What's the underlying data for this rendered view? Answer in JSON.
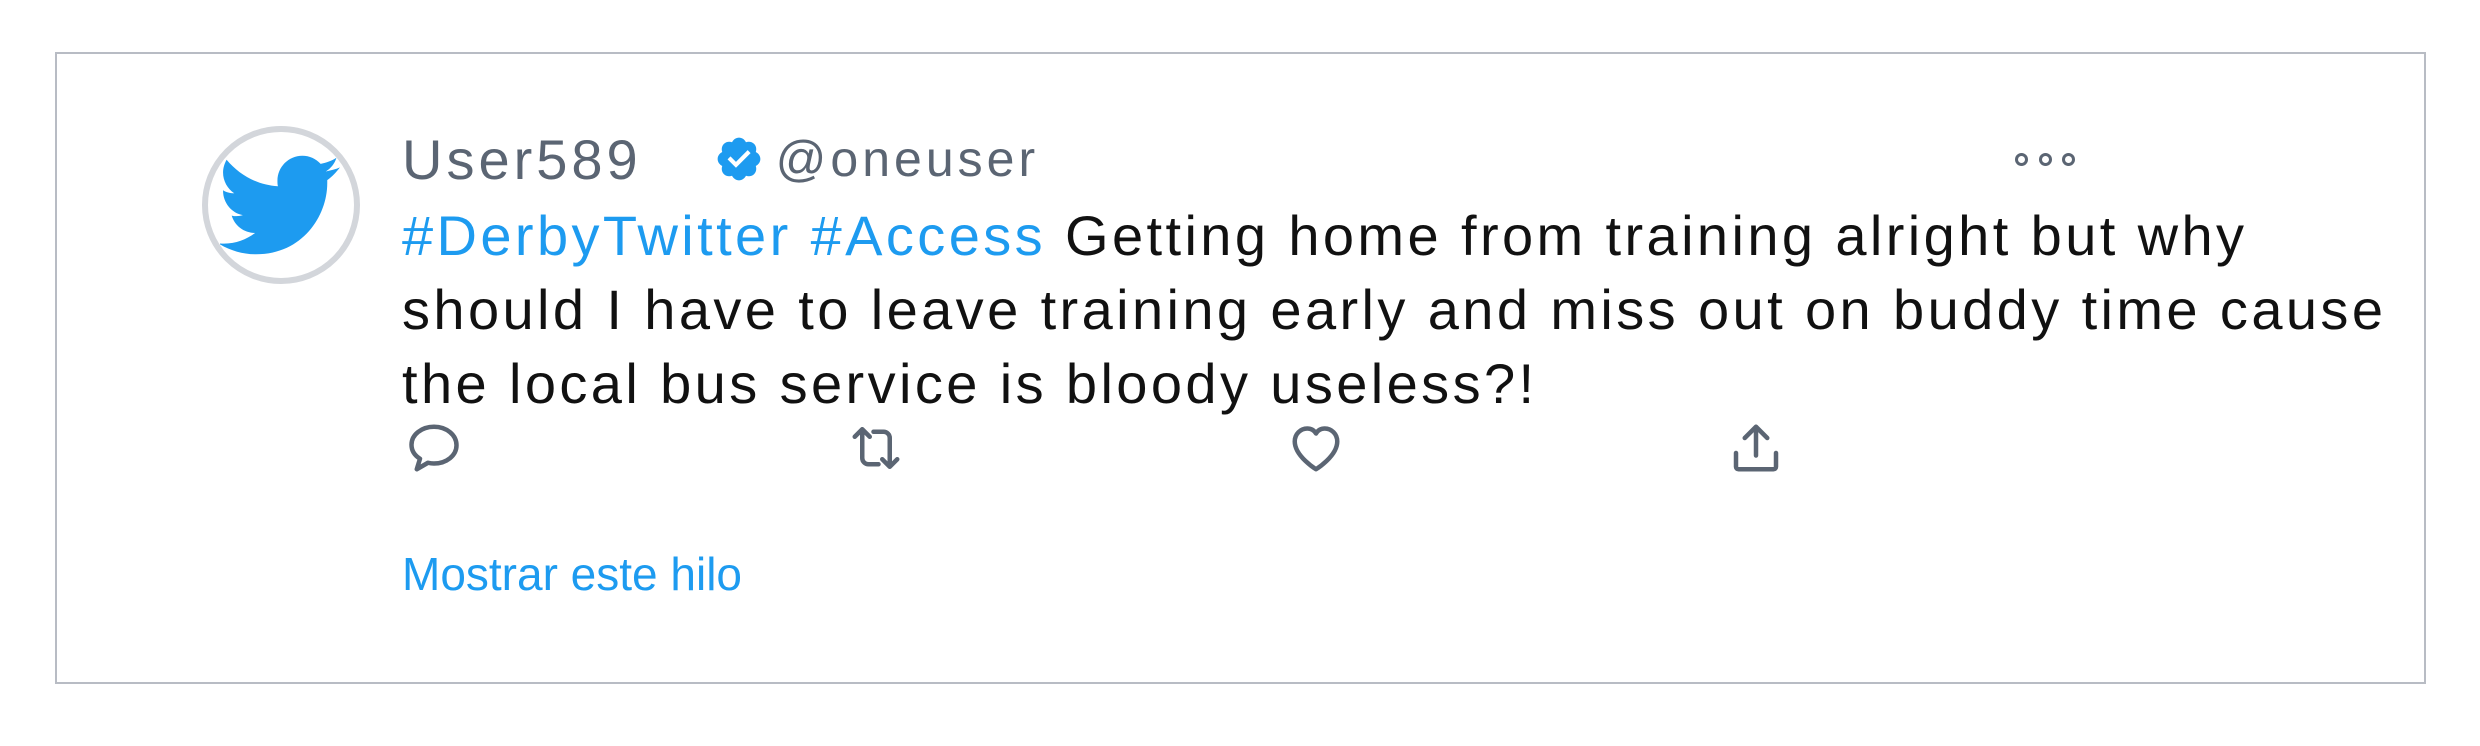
{
  "tweet": {
    "display_name": "User589",
    "handle": "@oneuser",
    "verified": true,
    "hashtags": [
      "#DerbyTwitter",
      "#Access"
    ],
    "body": "Getting home from training alright but why should I have to leave training early and miss out on buddy time cause the local bus service is bloody useless?!",
    "avatar_icon": "twitter-bird-icon",
    "more_icon": "more-options-icon"
  },
  "actions": {
    "reply_icon": "reply-icon",
    "retweet_icon": "retweet-icon",
    "like_icon": "like-icon",
    "share_icon": "share-icon"
  },
  "show_thread_label": "Mostrar este hilo",
  "colors": {
    "accent": "#1d9bf0",
    "muted": "#5b6573",
    "text": "#111111",
    "border": "#b8bcc4"
  }
}
